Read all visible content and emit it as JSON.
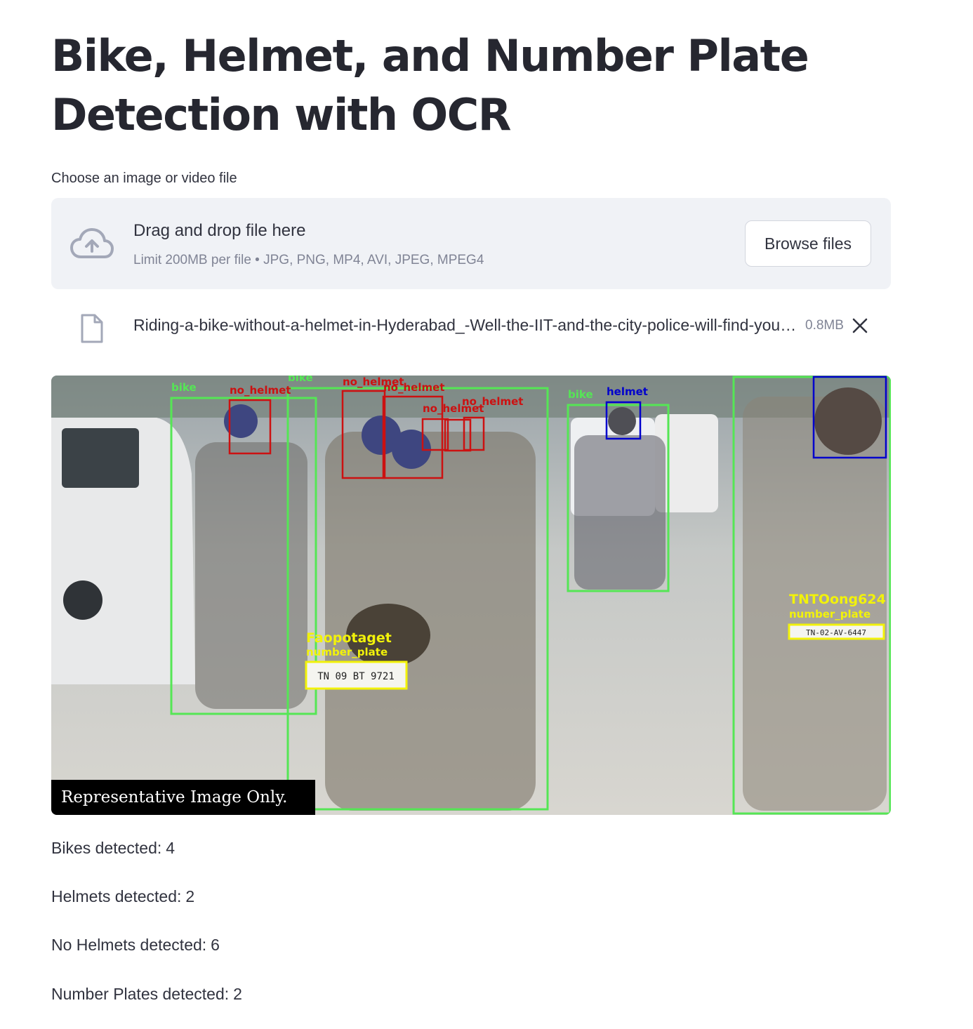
{
  "page": {
    "title": "Bike, Helmet, and Number Plate Detection with OCR"
  },
  "uploader": {
    "label": "Choose an image or video file",
    "drop_text": "Drag and drop file here",
    "limit_text": "Limit 200MB per file • JPG, PNG, MP4, AVI, JPEG, MPEG4",
    "browse_label": "Browse files",
    "icon": "cloud-upload-icon"
  },
  "uploaded_file": {
    "name": "Riding-a-bike-without-a-helmet-in-Hyderabad_-Well-the-IIT-and-the-city-police-will-find-you.jpg",
    "size": "0.8MB",
    "icon": "file-icon",
    "remove_icon": "close-icon"
  },
  "result_image": {
    "caption": "Representative Image Only.",
    "detection_labels": {
      "bike": "bike",
      "helmet": "helmet",
      "no_helmet": "no_helmet",
      "number_plate": "number_plate",
      "ocr_left": "Faopotaget",
      "ocr_right": "TNTOong624",
      "plate_left": "TN 09 BT 9721",
      "plate_right": "TN-02-AV-6447"
    },
    "colors": {
      "bike": "#55e655",
      "helmet": "#0000cc",
      "no_helmet": "#cc1111",
      "number_plate": "#f2f20a"
    }
  },
  "stats": [
    {
      "label": "Bikes detected:",
      "value": "4"
    },
    {
      "label": "Helmets detected:",
      "value": "2"
    },
    {
      "label": "No Helmets detected:",
      "value": "6"
    },
    {
      "label": "Number Plates detected:",
      "value": "2"
    }
  ]
}
